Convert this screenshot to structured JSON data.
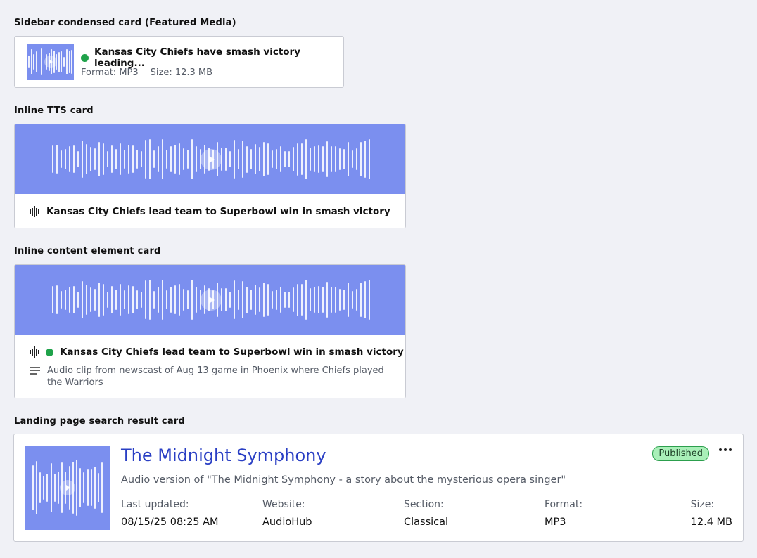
{
  "sections": {
    "sidebar": "Sidebar condensed card (Featured Media)",
    "inline_tts": "Inline TTS card",
    "inline_content": "Inline content element card",
    "landing": "Landing page search result card"
  },
  "sidebar_card": {
    "title": "Kansas City Chiefs have smash victory leading...",
    "format": "Format: MP3",
    "size": "Size: 12.3 MB",
    "status_color": "#1fa24a"
  },
  "tts_card": {
    "title": "Kansas City Chiefs lead team to Superbowl win in smash victory"
  },
  "content_card": {
    "title": "Kansas City Chiefs lead team to Superbowl win in smash victory",
    "description": "Audio clip from newscast of Aug 13 game in Phoenix where Chiefs played the Warriors"
  },
  "landing_card": {
    "title": "The Midnight Symphony",
    "subtitle": "Audio version of \"The Midnight Symphony - a story about the mysterious opera singer\"",
    "status": "Published",
    "more_icon": "more-horizontal-icon",
    "fields": [
      {
        "label": "Last updated:",
        "value": "08/15/25 08:25 AM"
      },
      {
        "label": "Website:",
        "value": "AudioHub"
      },
      {
        "label": "Section:",
        "value": "Classical"
      },
      {
        "label": "Format:",
        "value": "MP3"
      },
      {
        "label": "Size:",
        "value": "12.4 MB"
      }
    ]
  },
  "colors": {
    "accent_wave": "#7b8fef",
    "title_link": "#2a3fc4",
    "published_bg": "#a9efb8",
    "published_border": "#2c9f4d"
  }
}
